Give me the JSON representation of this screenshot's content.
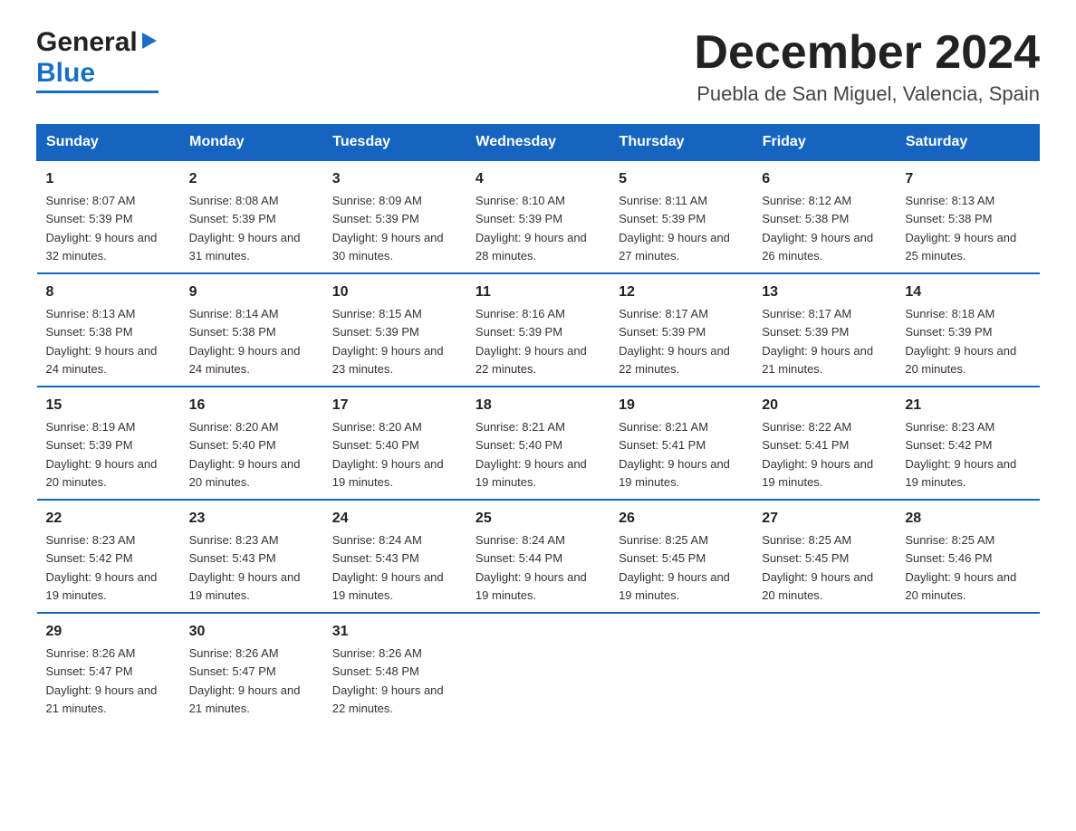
{
  "header": {
    "logo_general": "General",
    "logo_blue": "Blue",
    "title": "December 2024",
    "location": "Puebla de San Miguel, Valencia, Spain"
  },
  "weekdays": [
    "Sunday",
    "Monday",
    "Tuesday",
    "Wednesday",
    "Thursday",
    "Friday",
    "Saturday"
  ],
  "weeks": [
    [
      {
        "day": "1",
        "sunrise": "8:07 AM",
        "sunset": "5:39 PM",
        "daylight": "9 hours and 32 minutes."
      },
      {
        "day": "2",
        "sunrise": "8:08 AM",
        "sunset": "5:39 PM",
        "daylight": "9 hours and 31 minutes."
      },
      {
        "day": "3",
        "sunrise": "8:09 AM",
        "sunset": "5:39 PM",
        "daylight": "9 hours and 30 minutes."
      },
      {
        "day": "4",
        "sunrise": "8:10 AM",
        "sunset": "5:39 PM",
        "daylight": "9 hours and 28 minutes."
      },
      {
        "day": "5",
        "sunrise": "8:11 AM",
        "sunset": "5:39 PM",
        "daylight": "9 hours and 27 minutes."
      },
      {
        "day": "6",
        "sunrise": "8:12 AM",
        "sunset": "5:38 PM",
        "daylight": "9 hours and 26 minutes."
      },
      {
        "day": "7",
        "sunrise": "8:13 AM",
        "sunset": "5:38 PM",
        "daylight": "9 hours and 25 minutes."
      }
    ],
    [
      {
        "day": "8",
        "sunrise": "8:13 AM",
        "sunset": "5:38 PM",
        "daylight": "9 hours and 24 minutes."
      },
      {
        "day": "9",
        "sunrise": "8:14 AM",
        "sunset": "5:38 PM",
        "daylight": "9 hours and 24 minutes."
      },
      {
        "day": "10",
        "sunrise": "8:15 AM",
        "sunset": "5:39 PM",
        "daylight": "9 hours and 23 minutes."
      },
      {
        "day": "11",
        "sunrise": "8:16 AM",
        "sunset": "5:39 PM",
        "daylight": "9 hours and 22 minutes."
      },
      {
        "day": "12",
        "sunrise": "8:17 AM",
        "sunset": "5:39 PM",
        "daylight": "9 hours and 22 minutes."
      },
      {
        "day": "13",
        "sunrise": "8:17 AM",
        "sunset": "5:39 PM",
        "daylight": "9 hours and 21 minutes."
      },
      {
        "day": "14",
        "sunrise": "8:18 AM",
        "sunset": "5:39 PM",
        "daylight": "9 hours and 20 minutes."
      }
    ],
    [
      {
        "day": "15",
        "sunrise": "8:19 AM",
        "sunset": "5:39 PM",
        "daylight": "9 hours and 20 minutes."
      },
      {
        "day": "16",
        "sunrise": "8:20 AM",
        "sunset": "5:40 PM",
        "daylight": "9 hours and 20 minutes."
      },
      {
        "day": "17",
        "sunrise": "8:20 AM",
        "sunset": "5:40 PM",
        "daylight": "9 hours and 19 minutes."
      },
      {
        "day": "18",
        "sunrise": "8:21 AM",
        "sunset": "5:40 PM",
        "daylight": "9 hours and 19 minutes."
      },
      {
        "day": "19",
        "sunrise": "8:21 AM",
        "sunset": "5:41 PM",
        "daylight": "9 hours and 19 minutes."
      },
      {
        "day": "20",
        "sunrise": "8:22 AM",
        "sunset": "5:41 PM",
        "daylight": "9 hours and 19 minutes."
      },
      {
        "day": "21",
        "sunrise": "8:23 AM",
        "sunset": "5:42 PM",
        "daylight": "9 hours and 19 minutes."
      }
    ],
    [
      {
        "day": "22",
        "sunrise": "8:23 AM",
        "sunset": "5:42 PM",
        "daylight": "9 hours and 19 minutes."
      },
      {
        "day": "23",
        "sunrise": "8:23 AM",
        "sunset": "5:43 PM",
        "daylight": "9 hours and 19 minutes."
      },
      {
        "day": "24",
        "sunrise": "8:24 AM",
        "sunset": "5:43 PM",
        "daylight": "9 hours and 19 minutes."
      },
      {
        "day": "25",
        "sunrise": "8:24 AM",
        "sunset": "5:44 PM",
        "daylight": "9 hours and 19 minutes."
      },
      {
        "day": "26",
        "sunrise": "8:25 AM",
        "sunset": "5:45 PM",
        "daylight": "9 hours and 19 minutes."
      },
      {
        "day": "27",
        "sunrise": "8:25 AM",
        "sunset": "5:45 PM",
        "daylight": "9 hours and 20 minutes."
      },
      {
        "day": "28",
        "sunrise": "8:25 AM",
        "sunset": "5:46 PM",
        "daylight": "9 hours and 20 minutes."
      }
    ],
    [
      {
        "day": "29",
        "sunrise": "8:26 AM",
        "sunset": "5:47 PM",
        "daylight": "9 hours and 21 minutes."
      },
      {
        "day": "30",
        "sunrise": "8:26 AM",
        "sunset": "5:47 PM",
        "daylight": "9 hours and 21 minutes."
      },
      {
        "day": "31",
        "sunrise": "8:26 AM",
        "sunset": "5:48 PM",
        "daylight": "9 hours and 22 minutes."
      },
      null,
      null,
      null,
      null
    ]
  ],
  "labels": {
    "sunrise": "Sunrise:",
    "sunset": "Sunset:",
    "daylight": "Daylight:"
  }
}
